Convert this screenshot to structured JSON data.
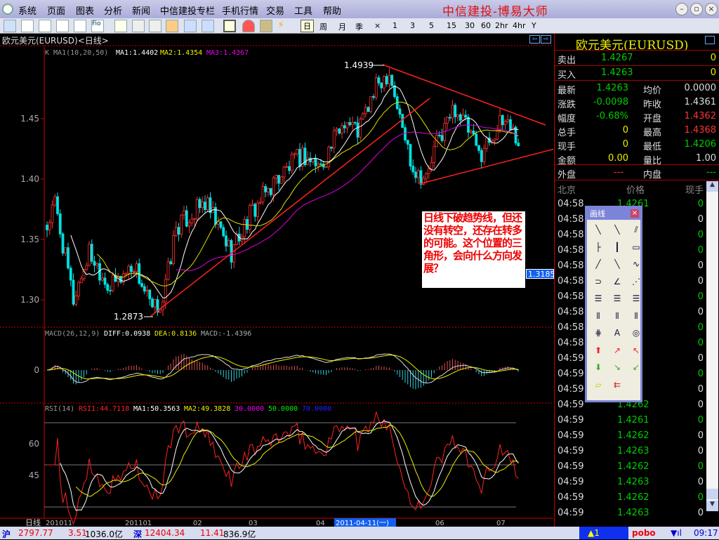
{
  "app": {
    "title": "中信建投-博易大师"
  },
  "menu": [
    "系统",
    "页面",
    "图表",
    "分析",
    "新闻",
    "中信建投专栏",
    "手机行情",
    "交易",
    "工具",
    "帮助"
  ],
  "periods": [
    "日",
    "周",
    "月",
    "季",
    "×",
    "1",
    "3",
    "5",
    "15",
    "30",
    "60",
    "2hr",
    "4hr",
    "Y"
  ],
  "chart": {
    "header": "欧元美元(EURUSD)<日线>",
    "ma_label": "K  MA1(10,20,50)",
    "ma1": "MA1:1.4402",
    "ma2": "MA2:1.4354",
    "ma3": "MA3:1.4367",
    "macd_label": "MACD(26,12,9)",
    "diff": "DIFF:0.0938",
    "dea": "DEA:0.8136",
    "macd": "MACD:-1.4396",
    "rsi_label": "RSI(14)",
    "rsi1": "RSI1:44.7118",
    "rsi_ma1": "MA1:50.3563",
    "rsi_ma2": "MA2:49.3828",
    "l30": "30.0000",
    "l50": "50.0000",
    "l70": "70.0000",
    "price_ticks": [
      "1.45",
      "1.40",
      "1.35",
      "1.30"
    ],
    "macd_ticks": [
      "0"
    ],
    "rsi_ticks": [
      "60",
      "45"
    ],
    "high_label": "1.4939",
    "low_label": "1.2873",
    "cursor_price": "1.3185",
    "period_label": "日线",
    "date_ticks": [
      "201011",
      "201101",
      "02",
      "03",
      "04",
      "06",
      "07"
    ],
    "cursor_date": "2011-04-11(一)",
    "annotation": "日线下破趋势线，但还没有转空，还存在转多的可能。这个位置的三角形，会向什么方向发展？",
    "colors": {
      "up": "#ff3030",
      "down": "#00e0e0",
      "ma1": "#ffffff",
      "ma2": "#e0e000",
      "ma3": "#e000e0",
      "trend": "#ff2020"
    }
  },
  "chart_data": {
    "type": "candlestick",
    "title": "欧元美元(EURUSD) 日线",
    "ylim": [
      1.25,
      1.52
    ],
    "close_outline_bars": [
      0,
      3,
      10,
      16,
      24,
      33,
      40,
      44,
      49,
      60,
      70,
      77,
      87,
      97,
      104,
      113,
      118,
      126,
      130,
      134,
      139,
      144,
      148,
      155,
      160,
      164,
      170,
      175,
      179
    ],
    "close_outline": [
      1.36,
      1.38,
      1.3,
      1.34,
      1.31,
      1.33,
      1.29,
      1.3,
      1.36,
      1.38,
      1.34,
      1.37,
      1.4,
      1.42,
      1.41,
      1.45,
      1.44,
      1.48,
      1.49,
      1.45,
      1.41,
      1.4,
      1.43,
      1.46,
      1.44,
      1.42,
      1.44,
      1.45,
      1.43
    ],
    "high": 1.4939,
    "low": 1.2873
  },
  "quote": {
    "title": "欧元美元(EURUSD)",
    "sell_label": "卖出",
    "sell": "1.4267",
    "sell_vol": "0",
    "buy_label": "买入",
    "buy": "1.4263",
    "buy_vol": "0",
    "rows": [
      {
        "l1": "最新",
        "v1": "1.4263",
        "c1": "g",
        "l2": "均价",
        "v2": "0.0000",
        "c2": "w"
      },
      {
        "l1": "涨跌",
        "v1": "-0.0098",
        "c1": "g",
        "l2": "昨收",
        "v2": "1.4361",
        "c2": "w"
      },
      {
        "l1": "幅度",
        "v1": "-0.68%",
        "c1": "g",
        "l2": "开盘",
        "v2": "1.4362",
        "c2": "r"
      },
      {
        "l1": "总手",
        "v1": "0",
        "c1": "y",
        "l2": "最高",
        "v2": "1.4368",
        "c2": "r"
      },
      {
        "l1": "现手",
        "v1": "0",
        "c1": "y",
        "l2": "最低",
        "v2": "1.4206",
        "c2": "g"
      },
      {
        "l1": "金额",
        "v1": "0.00",
        "c1": "y",
        "l2": "量比",
        "v2": "1.00",
        "c2": "w"
      }
    ],
    "outer_label": "外盘",
    "outer": "---",
    "inner_label": "内盘",
    "inner": "---",
    "tick_headers": [
      "北京",
      "价格",
      "现手"
    ],
    "ticks": [
      {
        "t": "04:58",
        "p": "1.4261",
        "v": "0",
        "vc": "g"
      },
      {
        "t": "04:58",
        "p": "",
        "v": "0",
        "vc": "w"
      },
      {
        "t": "04:58",
        "p": "",
        "v": "0",
        "vc": "g"
      },
      {
        "t": "04:58",
        "p": "",
        "v": "0",
        "vc": "g"
      },
      {
        "t": "04:58",
        "p": "",
        "v": "0",
        "vc": "w"
      },
      {
        "t": "04:58",
        "p": "",
        "v": "0",
        "vc": "w"
      },
      {
        "t": "04:58",
        "p": "",
        "v": "0",
        "vc": "g"
      },
      {
        "t": "04:58",
        "p": "",
        "v": "0",
        "vc": "w"
      },
      {
        "t": "04:58",
        "p": "",
        "v": "0",
        "vc": "g"
      },
      {
        "t": "04:58",
        "p": "",
        "v": "0",
        "vc": "g"
      },
      {
        "t": "04:59",
        "p": "",
        "v": "0",
        "vc": "w"
      },
      {
        "t": "04:59",
        "p": "",
        "v": "0",
        "vc": "g"
      },
      {
        "t": "04:59",
        "p": "",
        "v": "0",
        "vc": "w"
      },
      {
        "t": "04:59",
        "p": "1.4262",
        "v": "0",
        "vc": "w"
      },
      {
        "t": "04:59",
        "p": "1.4261",
        "v": "0",
        "vc": "g"
      },
      {
        "t": "04:59",
        "p": "1.4262",
        "v": "0",
        "vc": "w"
      },
      {
        "t": "04:59",
        "p": "1.4263",
        "v": "0",
        "vc": "w"
      },
      {
        "t": "04:59",
        "p": "1.4262",
        "v": "0",
        "vc": "g"
      },
      {
        "t": "04:59",
        "p": "1.4263",
        "v": "0",
        "vc": "w"
      },
      {
        "t": "04:59",
        "p": "1.4262",
        "v": "0",
        "vc": "g"
      },
      {
        "t": "04:59",
        "p": "1.4263",
        "v": "0",
        "vc": "w"
      }
    ]
  },
  "drawtool": {
    "title": "画线"
  },
  "status": {
    "sh_label": "沪",
    "sh": "2797.77",
    "sh_chg": "3.51",
    "sh_amt": "1036.0亿",
    "sz_label": "深",
    "sz": "12404.34",
    "sz_chg": "11.41",
    "sz_amt": "836.9亿",
    "alert": "1",
    "brand": "pobo",
    "time": "09:17"
  }
}
